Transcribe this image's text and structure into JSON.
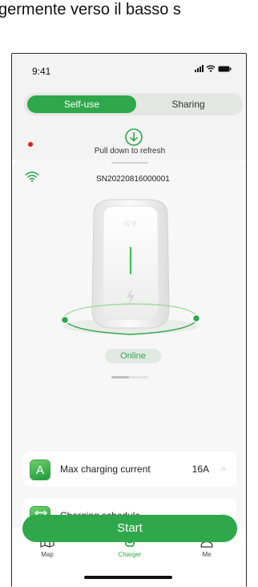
{
  "caption": {
    "text": "germente verso il basso s"
  },
  "status_bar": {
    "time": "9:41",
    "icons": [
      "signal-icon",
      "wifi-icon",
      "battery-icon"
    ]
  },
  "segment": {
    "active_label": "Self-use",
    "inactive_label": "Sharing"
  },
  "refresh": {
    "text": "Pull down to refresh"
  },
  "device": {
    "serial": "SN20220816000001",
    "status": "Online"
  },
  "settings": [
    {
      "icon_letter": "A",
      "icon": "current-icon",
      "label": "Max charging current",
      "value": "16A",
      "chevron": "»"
    },
    {
      "icon_letter": "",
      "icon": "alarm-clock-icon",
      "label": "Charging schedule",
      "value": "",
      "chevron": "»"
    }
  ],
  "start_button": {
    "label": "Start"
  },
  "tabs": [
    {
      "label": "Map",
      "icon": "map-icon",
      "active": false
    },
    {
      "label": "Charger",
      "icon": "charger-icon",
      "active": true
    },
    {
      "label": "Me",
      "icon": "person-icon",
      "active": false
    }
  ],
  "colors": {
    "accent": "#2ea84a",
    "alert": "#e81d1d"
  }
}
